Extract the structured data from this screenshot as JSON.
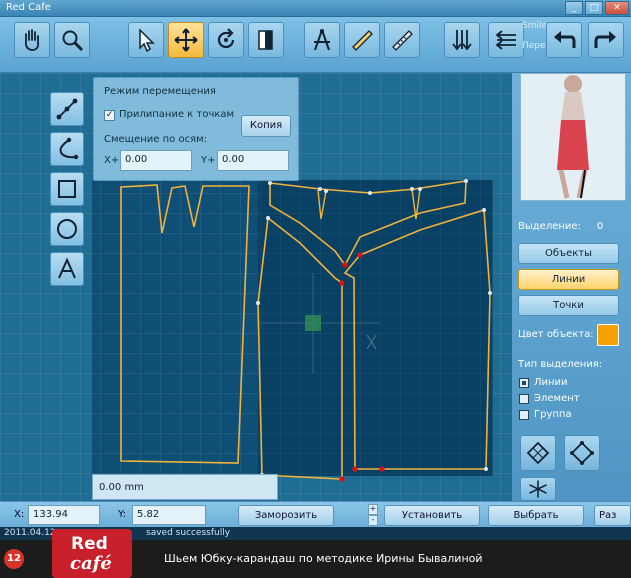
{
  "window": {
    "title": "Red Cafe",
    "controls": [
      "_",
      "□",
      "✕"
    ]
  },
  "toolbar": {
    "buttons": [
      {
        "icon": "hand-icon"
      },
      {
        "icon": "zoom-icon"
      },
      {
        "icon": "arrow-select-icon"
      },
      {
        "icon": "move-icon",
        "active": true
      },
      {
        "icon": "rotate-icon"
      },
      {
        "icon": "mirror-icon"
      },
      {
        "icon": "compass-icon"
      },
      {
        "icon": "ruler-icon"
      },
      {
        "icon": "ruler-scale-icon"
      },
      {
        "icon": "split-down-icon"
      },
      {
        "icon": "split-left-icon"
      },
      {
        "icon": "undo-icon"
      },
      {
        "icon": "redo-icon"
      }
    ],
    "faint_text_1": "Smile ru",
    "faint_text_2": "Пере"
  },
  "left_tools": [
    {
      "icon": "line-points-icon"
    },
    {
      "icon": "curve-icon"
    },
    {
      "icon": "rectangle-icon"
    },
    {
      "icon": "circle-icon"
    },
    {
      "icon": "text-icon"
    }
  ],
  "move_panel": {
    "title": "Режим перемещения",
    "snap_label": "Прилипание к точкам",
    "snap_checked": "✓",
    "copy_button": "Копия",
    "offset_label": "Смещение по осям:",
    "x_label": "X+",
    "x_value": "0.00",
    "y_label": "Y+",
    "y_value": "0.00"
  },
  "measure_field": "0.00 mm",
  "right_panel": {
    "selection_label": "Выделение:",
    "selection_count": "0",
    "btn_objects": "Объекты",
    "btn_lines": "Линии",
    "btn_points": "Точки",
    "color_label": "Цвет объекта:",
    "object_color": "#f5a200",
    "select_type_label": "Тип выделения:",
    "radio_lines": "Линии",
    "radio_element": "Элемент",
    "radio_group": "Группа"
  },
  "statusbar": {
    "x_label": "X:",
    "x_value": "133.94",
    "y_label": "Y:",
    "y_value": "5.82",
    "freeze": "Заморозить",
    "plus": "+",
    "minus": "-",
    "set": "Установить",
    "select": "Выбрать",
    "partial": "Раз"
  },
  "log_line": {
    "date": "2011.04.12",
    "message": "saved successfully"
  },
  "banner": {
    "number": "12",
    "logo_line1": "Red",
    "logo_line2": "café",
    "caption": "Шьем Юбку-карандаш по методике Ирины Бывалиной"
  }
}
